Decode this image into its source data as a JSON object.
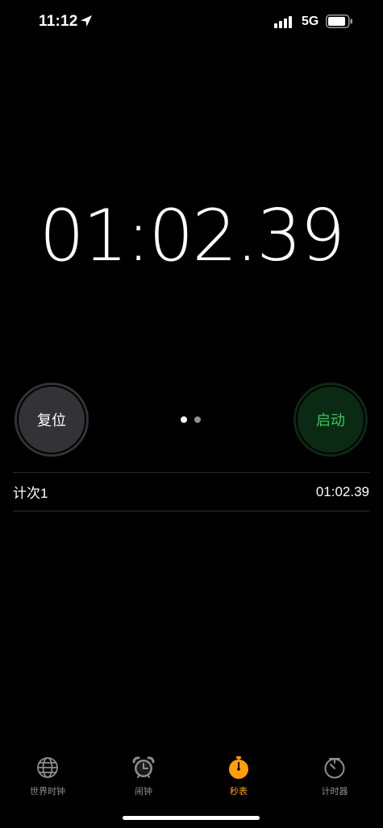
{
  "status_bar": {
    "time": "11:12",
    "network": "5G",
    "icons": [
      "location-arrow-icon",
      "cellular-signal-icon",
      "battery-icon"
    ]
  },
  "stopwatch": {
    "display": "01:02.39"
  },
  "controls": {
    "reset_label": "复位",
    "start_label": "启动",
    "page_indicator": {
      "count": 2,
      "active": 0
    }
  },
  "laps": [
    {
      "label": "计次1",
      "time": "01:02.39"
    }
  ],
  "tabs": [
    {
      "label": "世界时钟",
      "icon": "globe-icon",
      "active": false
    },
    {
      "label": "闹钟",
      "icon": "alarm-clock-icon",
      "active": false
    },
    {
      "label": "秒表",
      "icon": "stopwatch-icon",
      "active": true
    },
    {
      "label": "计时器",
      "icon": "timer-icon",
      "active": false
    }
  ],
  "colors": {
    "background": "#000000",
    "accent_active_tab": "#ff9f0a",
    "start_text": "#34c759",
    "start_bg": "#0b2a14",
    "reset_bg": "#333335",
    "inactive": "#8e8e93"
  }
}
